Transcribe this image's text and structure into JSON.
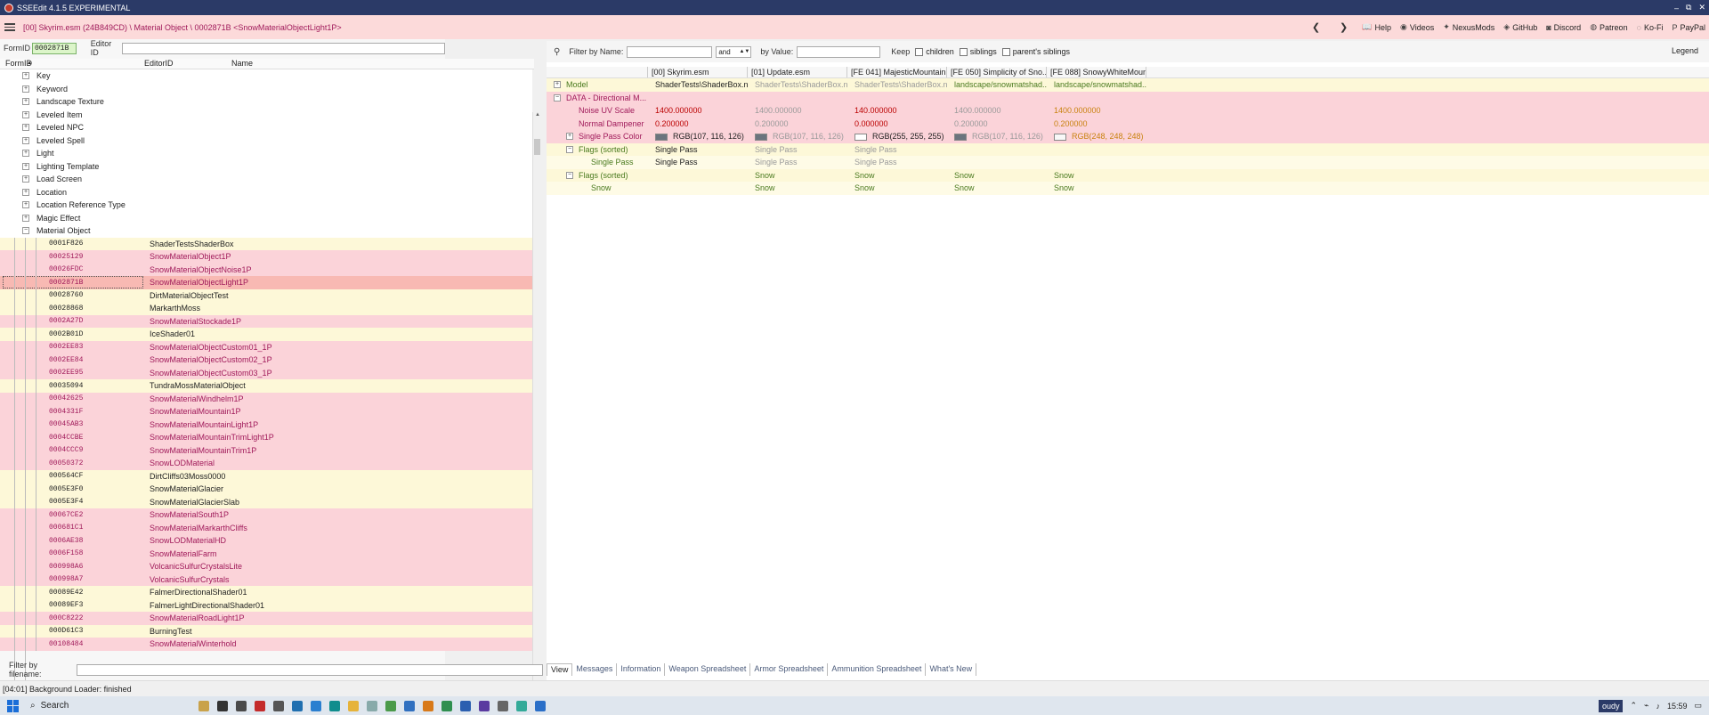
{
  "window": {
    "title": "SSEEdit 4.1.5 EXPERIMENTAL",
    "controls": [
      "–",
      "⧉",
      "✕"
    ]
  },
  "pathbar": {
    "path": "[00] Skyrim.esm (24B849CD) \\ Material Object \\ 0002871B <SnowMaterialObjectLight1P>"
  },
  "nav": {
    "back": "❮",
    "forward": "❯",
    "links": [
      {
        "icon": "📖",
        "label": "Help"
      },
      {
        "icon": "◉",
        "label": "Videos"
      },
      {
        "icon": "✦",
        "label": "NexusMods"
      },
      {
        "icon": "◈",
        "label": "GitHub"
      },
      {
        "icon": "◙",
        "label": "Discord"
      },
      {
        "icon": "◍",
        "label": "Patreon"
      },
      {
        "icon": "◌",
        "label": "Ko-Fi"
      },
      {
        "icon": "P",
        "label": "PayPal"
      }
    ]
  },
  "left": {
    "formid_label": "FormID",
    "formid_value": "0002871B",
    "editorid_label": "Editor ID",
    "headers": {
      "formid": "FormID",
      "sort": "▲",
      "editorid": "EditorID",
      "name": "Name"
    },
    "categories": [
      {
        "label": "Key",
        "state": "+"
      },
      {
        "label": "Keyword",
        "state": "+"
      },
      {
        "label": "Landscape Texture",
        "state": "+"
      },
      {
        "label": "Leveled Item",
        "state": "+"
      },
      {
        "label": "Leveled NPC",
        "state": "+"
      },
      {
        "label": "Leveled Spell",
        "state": "+"
      },
      {
        "label": "Light",
        "state": "+"
      },
      {
        "label": "Lighting Template",
        "state": "+"
      },
      {
        "label": "Load Screen",
        "state": "+"
      },
      {
        "label": "Location",
        "state": "+"
      },
      {
        "label": "Location Reference Type",
        "state": "+"
      },
      {
        "label": "Magic Effect",
        "state": "+"
      },
      {
        "label": "Material Object",
        "state": "−"
      }
    ],
    "items": [
      {
        "fid": "0001F826",
        "name": "ShaderTestsShaderBox",
        "c": "yellow"
      },
      {
        "fid": "00025129",
        "name": "SnowMaterialObject1P",
        "c": "pink"
      },
      {
        "fid": "00026FDC",
        "name": "SnowMaterialObjectNoise1P",
        "c": "pink"
      },
      {
        "fid": "0002871B",
        "name": "SnowMaterialObjectLight1P",
        "c": "sel"
      },
      {
        "fid": "00028760",
        "name": "DirtMaterialObjectTest",
        "c": "yellow"
      },
      {
        "fid": "00028868",
        "name": "MarkarthMoss",
        "c": "yellow"
      },
      {
        "fid": "0002A27D",
        "name": "SnowMaterialStockade1P",
        "c": "pink"
      },
      {
        "fid": "0002B01D",
        "name": "IceShader01",
        "c": "yellow"
      },
      {
        "fid": "0002EE83",
        "name": "SnowMaterialObjectCustom01_1P",
        "c": "pink"
      },
      {
        "fid": "0002EE84",
        "name": "SnowMaterialObjectCustom02_1P",
        "c": "pink"
      },
      {
        "fid": "0002EE95",
        "name": "SnowMaterialObjectCustom03_1P",
        "c": "pink"
      },
      {
        "fid": "00035094",
        "name": "TundraMossMaterialObject",
        "c": "yellow"
      },
      {
        "fid": "00042625",
        "name": "SnowMaterialWindhelm1P",
        "c": "pink"
      },
      {
        "fid": "0004331F",
        "name": "SnowMaterialMountain1P",
        "c": "pink"
      },
      {
        "fid": "00045AB3",
        "name": "SnowMaterialMountainLight1P",
        "c": "pink"
      },
      {
        "fid": "0004CCBE",
        "name": "SnowMaterialMountainTrimLight1P",
        "c": "pink"
      },
      {
        "fid": "0004CCC9",
        "name": "SnowMaterialMountainTrim1P",
        "c": "pink"
      },
      {
        "fid": "00050372",
        "name": "SnowLODMaterial",
        "c": "pink"
      },
      {
        "fid": "000564CF",
        "name": "DirtCliffs03Moss0000",
        "c": "yellow"
      },
      {
        "fid": "0005E3F0",
        "name": "SnowMaterialGlacier",
        "c": "yellow"
      },
      {
        "fid": "0005E3F4",
        "name": "SnowMaterialGlacierSlab",
        "c": "yellow"
      },
      {
        "fid": "00067CE2",
        "name": "SnowMaterialSouth1P",
        "c": "pink"
      },
      {
        "fid": "000681C1",
        "name": "SnowMaterialMarkarthCliffs",
        "c": "pink"
      },
      {
        "fid": "0006AE38",
        "name": "SnowLODMaterialHD",
        "c": "pink"
      },
      {
        "fid": "0006F158",
        "name": "SnowMaterialFarm",
        "c": "pink"
      },
      {
        "fid": "000998A6",
        "name": "VolcanicSulfurCrystalsLite",
        "c": "pink"
      },
      {
        "fid": "000998A7",
        "name": "VolcanicSulfurCrystals",
        "c": "pink"
      },
      {
        "fid": "00089E42",
        "name": "FalmerDirectionalShader01",
        "c": "yellow"
      },
      {
        "fid": "00089EF3",
        "name": "FalmerLightDirectionalShader01",
        "c": "yellow"
      },
      {
        "fid": "000C8222",
        "name": "SnowMaterialRoadLight1P",
        "c": "pink"
      },
      {
        "fid": "000D61C3",
        "name": "BurningTest",
        "c": "yellow"
      },
      {
        "fid": "00108484",
        "name": "SnowMaterialWinterhold",
        "c": "pink"
      }
    ],
    "filter_filename_label": "Filter by filename:"
  },
  "right": {
    "filter": {
      "name_label": "Filter by Name:",
      "op": "and",
      "value_label": "by Value:",
      "keep_label": "Keep",
      "children": "children",
      "siblings": "siblings",
      "parents_siblings": "parent's siblings",
      "legend": "Legend"
    },
    "headers": [
      "",
      "[00] Skyrim.esm",
      "[01] Update.esm",
      "[FE 041] MajesticMountain...",
      "[FE 050] Simplicity of Sno...",
      "[FE 088] SnowyWhiteMoun..."
    ],
    "rows": [
      {
        "label": "Model",
        "exp": "+",
        "indent": 0,
        "bg": "yellow",
        "lc": "lbl-green",
        "cells": [
          {
            "t": "ShaderTests\\ShaderBox.nif",
            "c": "v-dark"
          },
          {
            "t": "ShaderTests\\ShaderBox.nif",
            "c": "v-gray"
          },
          {
            "t": "ShaderTests\\ShaderBox.nif",
            "c": "v-gray"
          },
          {
            "t": "landscape/snowmatshad...",
            "c": "v-green"
          },
          {
            "t": "landscape/snowmatshad...",
            "c": "v-green"
          }
        ]
      },
      {
        "label": "DATA - Directional M...",
        "exp": "−",
        "indent": 0,
        "bg": "pink",
        "lc": "lbl-red",
        "cells": [
          {
            "t": "",
            "c": ""
          },
          {
            "t": "",
            "c": ""
          },
          {
            "t": "",
            "c": ""
          },
          {
            "t": "",
            "c": ""
          },
          {
            "t": "",
            "c": ""
          }
        ]
      },
      {
        "label": "Noise UV Scale",
        "exp": "",
        "indent": 1,
        "bg": "pink",
        "lc": "lbl-red",
        "cells": [
          {
            "t": "1400.000000",
            "c": "v-red"
          },
          {
            "t": "1400.000000",
            "c": "v-gray"
          },
          {
            "t": "140.000000",
            "c": "v-red"
          },
          {
            "t": "1400.000000",
            "c": "v-gray"
          },
          {
            "t": "1400.000000",
            "c": "v-orange"
          }
        ]
      },
      {
        "label": "Normal Dampener",
        "exp": "",
        "indent": 1,
        "bg": "pink",
        "lc": "lbl-red",
        "cells": [
          {
            "t": "0.200000",
            "c": "v-red"
          },
          {
            "t": "0.200000",
            "c": "v-gray"
          },
          {
            "t": "0.000000",
            "c": "v-red"
          },
          {
            "t": "0.200000",
            "c": "v-gray"
          },
          {
            "t": "0.200000",
            "c": "v-orange"
          }
        ]
      },
      {
        "label": "Single Pass Color",
        "exp": "+",
        "indent": 1,
        "bg": "pink",
        "lc": "lbl-red",
        "cells": [
          {
            "t": "RGB(107, 116, 126)",
            "c": "v-dark",
            "sw": "#6b747e"
          },
          {
            "t": "RGB(107, 116, 126)",
            "c": "v-gray",
            "sw": "#6b747e"
          },
          {
            "t": "RGB(255, 255, 255)",
            "c": "v-dark",
            "sw": "#ffffff"
          },
          {
            "t": "RGB(107, 116, 126)",
            "c": "v-gray",
            "sw": "#6b747e"
          },
          {
            "t": "RGB(248, 248, 248)",
            "c": "v-orange",
            "sw": "#f8f8f8"
          }
        ]
      },
      {
        "label": "Flags (sorted)",
        "exp": "−",
        "indent": 1,
        "bg": "yellow",
        "lc": "lbl-green",
        "cells": [
          {
            "t": "Single Pass",
            "c": "v-dark"
          },
          {
            "t": "Single Pass",
            "c": "v-gray"
          },
          {
            "t": "Single Pass",
            "c": "v-gray"
          },
          {
            "t": "",
            "c": ""
          },
          {
            "t": "",
            "c": ""
          }
        ]
      },
      {
        "label": "Single Pass",
        "exp": "",
        "indent": 2,
        "bg": "lyel",
        "lc": "lbl-green",
        "cells": [
          {
            "t": "Single Pass",
            "c": "v-dark"
          },
          {
            "t": "Single Pass",
            "c": "v-gray"
          },
          {
            "t": "Single Pass",
            "c": "v-gray"
          },
          {
            "t": "",
            "c": ""
          },
          {
            "t": "",
            "c": ""
          }
        ]
      },
      {
        "label": "Flags (sorted)",
        "exp": "−",
        "indent": 1,
        "bg": "yellow",
        "lc": "lbl-green",
        "cells": [
          {
            "t": "",
            "c": ""
          },
          {
            "t": "Snow",
            "c": "v-green"
          },
          {
            "t": "Snow",
            "c": "v-green"
          },
          {
            "t": "Snow",
            "c": "v-green"
          },
          {
            "t": "Snow",
            "c": "v-green"
          }
        ]
      },
      {
        "label": "Snow",
        "exp": "",
        "indent": 2,
        "bg": "lyel",
        "lc": "lbl-green",
        "cells": [
          {
            "t": "",
            "c": ""
          },
          {
            "t": "Snow",
            "c": "v-green"
          },
          {
            "t": "Snow",
            "c": "v-green"
          },
          {
            "t": "Snow",
            "c": "v-green"
          },
          {
            "t": "Snow",
            "c": "v-green"
          }
        ]
      }
    ],
    "tabs": [
      "View",
      "Messages",
      "Information",
      "Weapon Spreadsheet",
      "Armor Spreadsheet",
      "Ammunition Spreadsheet",
      "What's New"
    ]
  },
  "status": {
    "text": "[04:01] Background Loader: finished"
  },
  "taskbar": {
    "search": "Search",
    "tray_text": "oudy",
    "time": "15:59"
  }
}
